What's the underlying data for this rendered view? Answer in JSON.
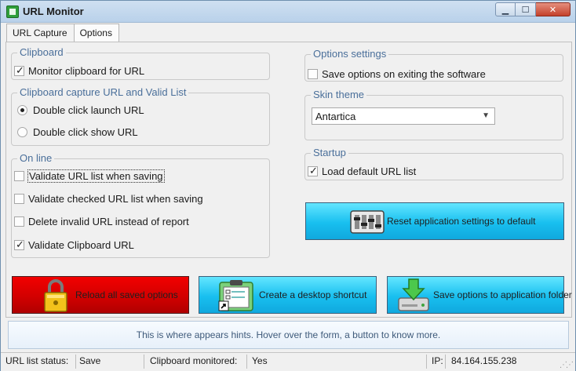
{
  "window": {
    "title": "URL Monitor"
  },
  "tabs": [
    {
      "label": "URL Capture",
      "active": false
    },
    {
      "label": "Options",
      "active": true
    }
  ],
  "clipboard": {
    "title": "Clipboard",
    "monitor_label": "Monitor clipboard for URL",
    "monitor_checked": true
  },
  "capture": {
    "title": "Clipboard capture URL and Valid List",
    "options": [
      {
        "label": "Double click launch URL",
        "selected": true
      },
      {
        "label": "Double click show URL",
        "selected": false
      }
    ]
  },
  "online": {
    "title": "On line",
    "items": [
      {
        "label": "Validate URL list when saving",
        "checked": false
      },
      {
        "label": "Validate checked URL list when saving",
        "checked": false
      },
      {
        "label": "Delete invalid URL instead of report",
        "checked": false
      },
      {
        "label": "Validate Clipboard URL",
        "checked": true
      }
    ]
  },
  "options_settings": {
    "title": "Options settings",
    "save_on_exit_label": "Save options on exiting the software",
    "save_on_exit_checked": false
  },
  "skin": {
    "title": "Skin theme",
    "selected": "Antartica"
  },
  "startup": {
    "title": "Startup",
    "load_default_label": "Load default URL list",
    "load_default_checked": true
  },
  "buttons": {
    "reset": "Reset application settings to default",
    "reload": "Reload all saved options",
    "shortcut": "Create a desktop shortcut",
    "save": "Save options to application folder"
  },
  "hint": "This is where appears hints. Hover over the form, a button to know more.",
  "status": {
    "list_label": "URL list status:",
    "list_value": "Save",
    "clip_label": "Clipboard monitored:",
    "clip_value": "Yes",
    "ip_label": "IP:",
    "ip_value": "84.164.155.238"
  },
  "colors": {
    "reset_button": "#18bfef",
    "reload_button": "#d20000",
    "group_title": "#4a6f9a"
  }
}
